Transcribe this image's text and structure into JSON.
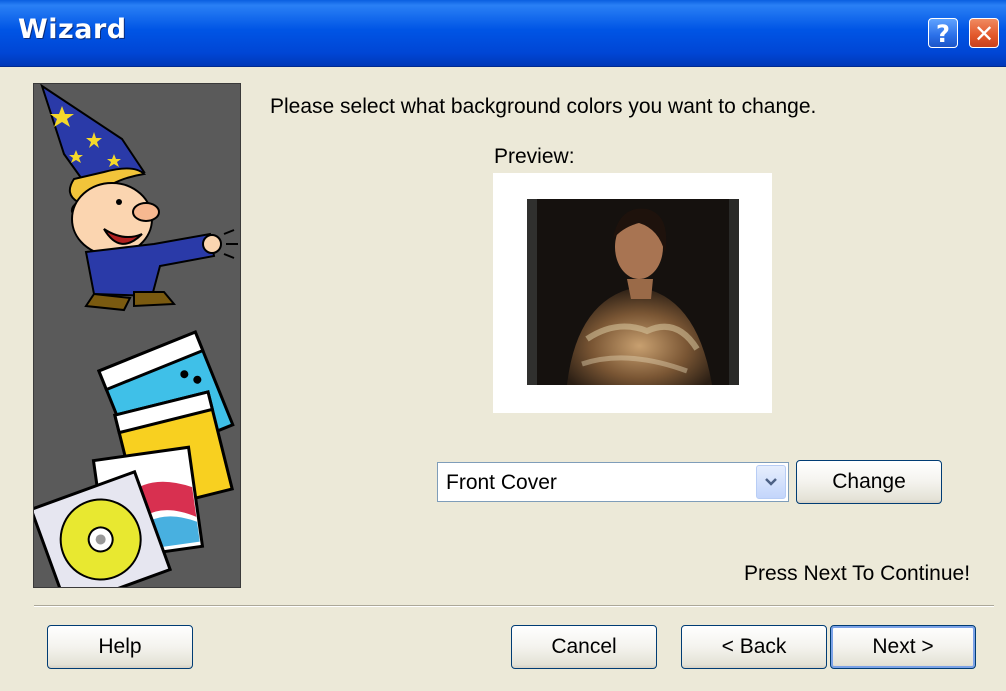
{
  "window": {
    "title": "Wizard",
    "help_glyph": "?",
    "close_glyph": "✕"
  },
  "wizard_art": {
    "icon": "wizard-illustration"
  },
  "content": {
    "prompt": "Please select what background colors you want to change.",
    "preview_label": "Preview:",
    "selected_option": "Front Cover",
    "change_button": "Change",
    "continue_hint": "Press Next To Continue!"
  },
  "footer": {
    "help": "Help",
    "cancel": "Cancel",
    "back": "< Back",
    "next": "Next >"
  }
}
